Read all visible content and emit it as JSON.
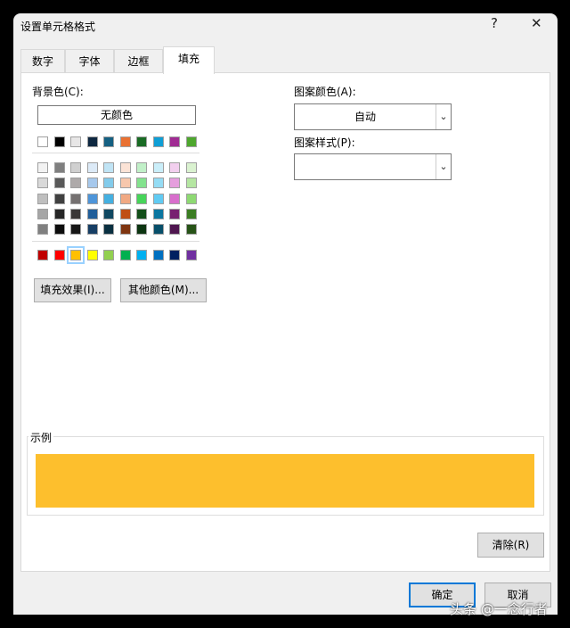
{
  "title": "设置单元格格式",
  "help_label": "?",
  "close_label": "✕",
  "tabs": [
    {
      "label": "数字"
    },
    {
      "label": "字体"
    },
    {
      "label": "边框"
    },
    {
      "label": "填充"
    }
  ],
  "active_tab": "填充",
  "background": {
    "label": "背景色(C):",
    "no_color": "无颜色",
    "theme_row": [
      "#ffffff",
      "#000000",
      "#e7e6e6",
      "#0e2841",
      "#156082",
      "#e97132",
      "#196b24",
      "#0f9ed5",
      "#a02b93",
      "#4ea72e"
    ],
    "shades": [
      [
        "#f2f2f2",
        "#7f7f7f",
        "#d0d0d0",
        "#dceaf7",
        "#c0e4f5",
        "#fbe3d6",
        "#c1f0c8",
        "#caeef9",
        "#f2cfee",
        "#daf2d0"
      ],
      [
        "#d9d9d9",
        "#595959",
        "#aeaaaa",
        "#a6c8ec",
        "#83cbeb",
        "#f7c7ac",
        "#83e28e",
        "#95dcf4",
        "#e59edd",
        "#b5e6a2"
      ],
      [
        "#bfbfbf",
        "#404040",
        "#757171",
        "#4e95d9",
        "#45b0e1",
        "#f1a983",
        "#47d45a",
        "#61cbf3",
        "#d86ecc",
        "#8ed973"
      ],
      [
        "#a6a6a6",
        "#262626",
        "#3a3838",
        "#215f9a",
        "#104861",
        "#c04f15",
        "#134f1a",
        "#0b76a0",
        "#782170",
        "#3b7d23"
      ],
      [
        "#808080",
        "#0d0d0d",
        "#171717",
        "#163e64",
        "#0a3041",
        "#7f3510",
        "#0c3511",
        "#074f6a",
        "#4f1650",
        "#275317"
      ]
    ],
    "standard_row": [
      "#c00000",
      "#ff0000",
      "#ffc000",
      "#ffff00",
      "#92d050",
      "#00b050",
      "#00b0f0",
      "#0070c0",
      "#002060",
      "#7030a0"
    ],
    "selected": "#ffc000",
    "fill_effects": "填充效果(I)...",
    "more_colors": "其他颜色(M)..."
  },
  "pattern": {
    "color_label": "图案颜色(A):",
    "color_value": "自动",
    "style_label": "图案样式(P):",
    "style_value": ""
  },
  "sample": {
    "label": "示例",
    "color": "#fdbf2d"
  },
  "clear_label": "清除(R)",
  "ok_label": "确定",
  "cancel_label": "取消",
  "watermark": "头条 @一念行者"
}
